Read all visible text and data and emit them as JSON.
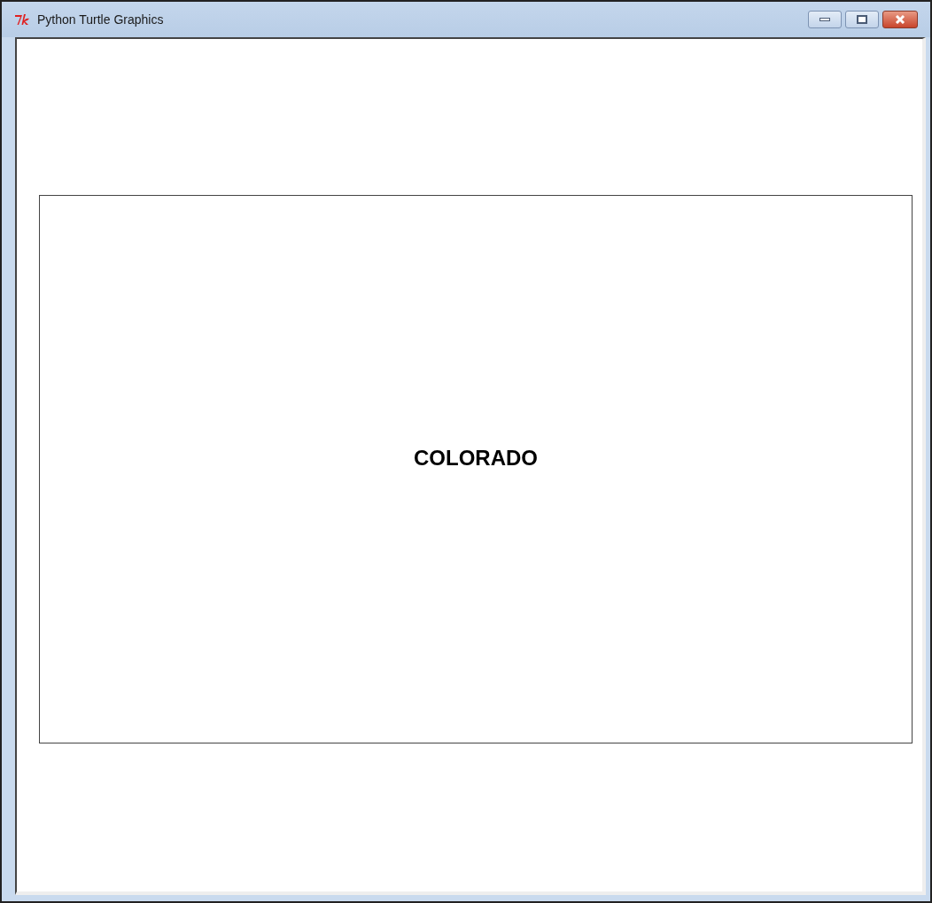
{
  "window": {
    "title": "Python Turtle Graphics"
  },
  "canvas": {
    "label": "COLORADO"
  }
}
